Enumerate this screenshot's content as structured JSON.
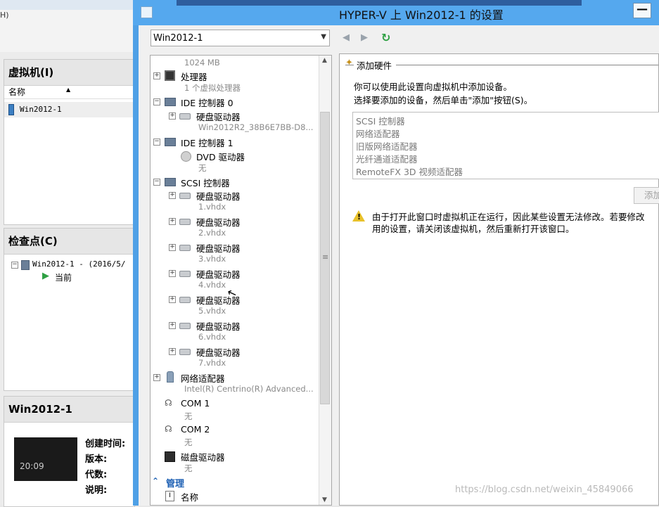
{
  "background_window": {
    "menu_fragment": "H)",
    "vm_panel": {
      "title": "虚拟机(I)",
      "column_header": "名称",
      "rows": [
        "Win2012-1"
      ]
    },
    "checkpoints_panel": {
      "title": "检查点(C)",
      "items": [
        "Win2012-1 - (2016/5/",
        "当前"
      ]
    },
    "details_panel": {
      "title": "Win2012-1",
      "thumbnail_time": "20:09",
      "labels": [
        "创建时间:",
        "版本:",
        "代数:",
        "说明:"
      ]
    }
  },
  "dialog": {
    "title": "HYPER-V 上 Win2012-1 的设置",
    "minimize_label": "—",
    "vm_select": {
      "value": "Win2012-1"
    },
    "hardware_tree": {
      "memory_sub": "1024 MB",
      "processor": {
        "label": "处理器",
        "sub": "1 个虚拟处理器"
      },
      "ide0": {
        "label": "IDE 控制器 0",
        "disk_label": "硬盘驱动器",
        "disk_sub": "Win2012R2_38B6E7BB-D8..."
      },
      "ide1": {
        "label": "IDE 控制器 1",
        "dvd_label": "DVD 驱动器",
        "dvd_sub": "无"
      },
      "scsi": {
        "label": "SCSI 控制器",
        "disks": [
          {
            "label": "硬盘驱动器",
            "sub": "1.vhdx"
          },
          {
            "label": "硬盘驱动器",
            "sub": "2.vhdx"
          },
          {
            "label": "硬盘驱动器",
            "sub": "3.vhdx"
          },
          {
            "label": "硬盘驱动器",
            "sub": "4.vhdx"
          },
          {
            "label": "硬盘驱动器",
            "sub": "5.vhdx"
          },
          {
            "label": "硬盘驱动器",
            "sub": "6.vhdx"
          },
          {
            "label": "硬盘驱动器",
            "sub": "7.vhdx"
          }
        ]
      },
      "network": {
        "label": "网络适配器",
        "sub": "Intel(R) Centrino(R) Advanced..."
      },
      "com1": {
        "label": "COM 1",
        "sub": "无"
      },
      "com2": {
        "label": "COM 2",
        "sub": "无"
      },
      "floppy": {
        "label": "磁盘驱动器",
        "sub": "无"
      },
      "management": "管理",
      "name_item": "名称"
    },
    "add_hardware": {
      "group_title": "添加硬件",
      "description_line1": "你可以使用此设置向虚拟机中添加设备。",
      "description_line2": "选择要添加的设备，然后单击\"添加\"按钮(S)。",
      "devices": [
        "SCSI 控制器",
        "网络适配器",
        "旧版网络适配器",
        "光纤通道适配器",
        "RemoteFX 3D 视频适配器"
      ],
      "add_button": "添加",
      "warning_line1": "由于打开此窗口时虚拟机正在运行，因此某些设置无法修改。若要修改",
      "warning_line2": "用的设置，请关闭该虚拟机，然后重新打开该窗口。"
    },
    "watermark": "https://blog.csdn.net/weixin_45849066"
  },
  "colors": {
    "titlebar": "#55a8ee",
    "management_link": "#1c5fb3",
    "warning": "#e8c12a",
    "refresh": "#2ea043"
  }
}
